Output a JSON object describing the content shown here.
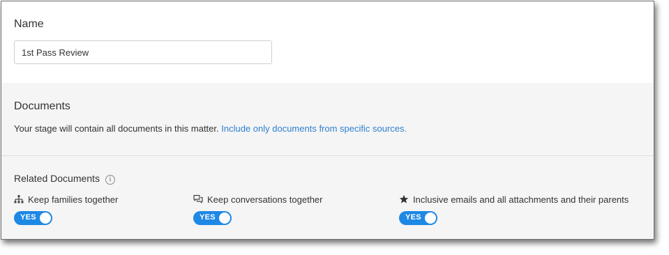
{
  "name_section": {
    "label": "Name",
    "input_value": "1st Pass Review"
  },
  "documents": {
    "label": "Documents",
    "description": "Your stage will contain all documents in this matter.",
    "link_text": "Include only documents from specific sources."
  },
  "related": {
    "label": "Related Documents",
    "info_icon": "i",
    "options": [
      {
        "icon": "hierarchy-icon",
        "label": "Keep families together",
        "toggle": "YES"
      },
      {
        "icon": "conversation-icon",
        "label": "Keep conversations together",
        "toggle": "YES"
      },
      {
        "icon": "star-icon",
        "label": "Inclusive emails and all attachments and their parents",
        "toggle": "YES"
      }
    ]
  },
  "colors": {
    "accent": "#1e88e5",
    "link": "#2f80d1",
    "grey_background": "#f5f5f5"
  }
}
